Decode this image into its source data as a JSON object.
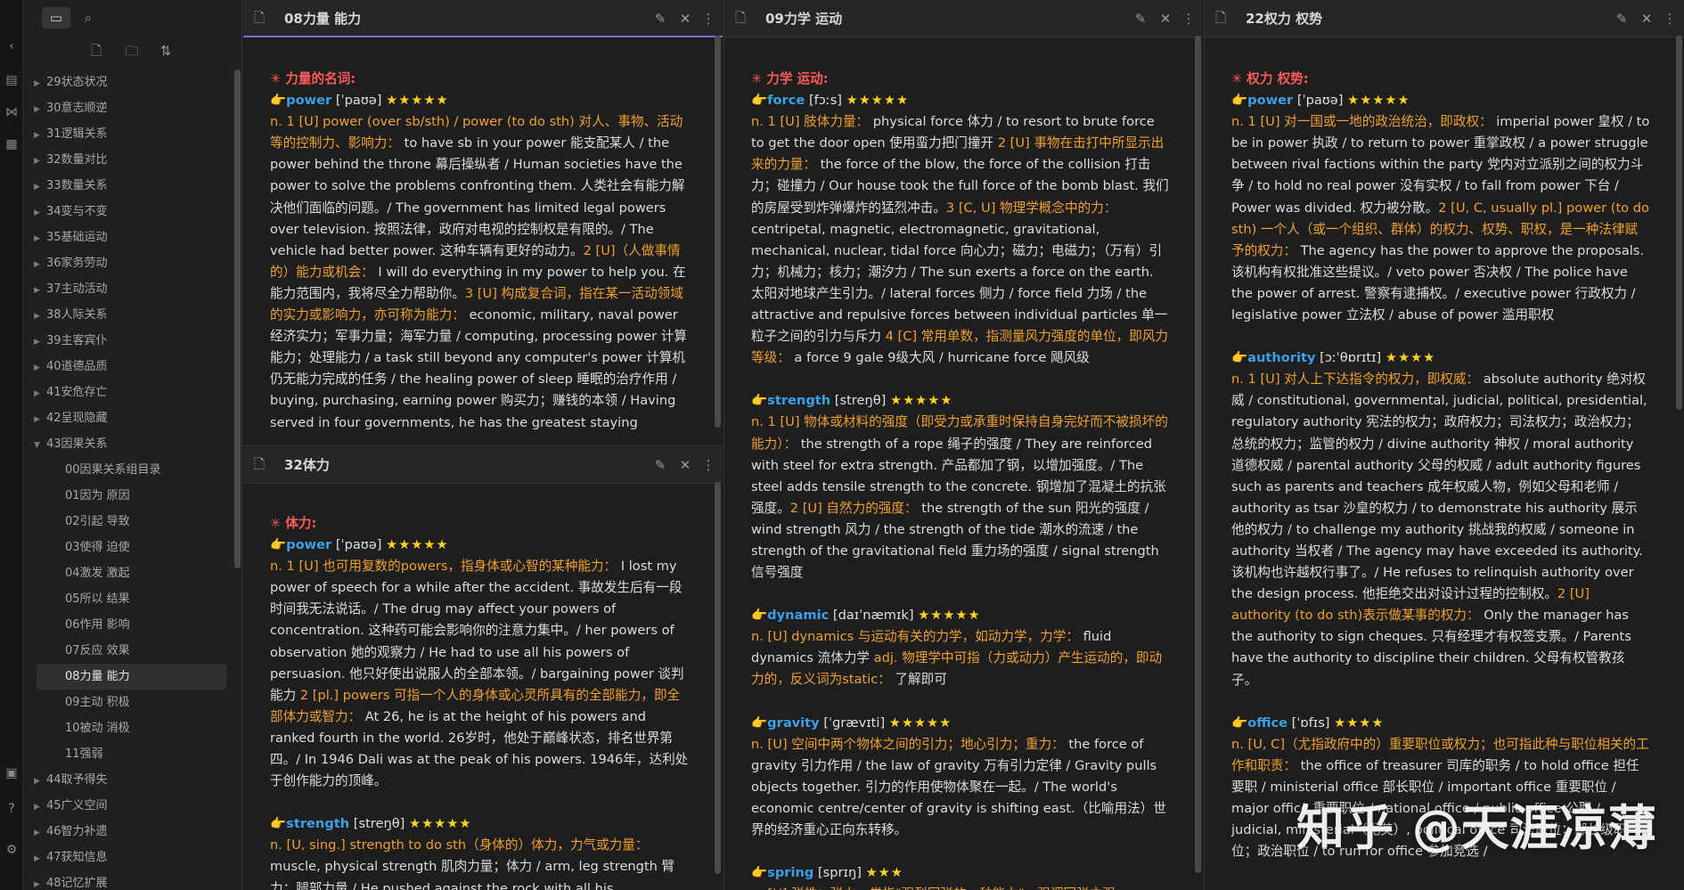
{
  "ribbon": {
    "icons": [
      "collapse-icon",
      "file-icon",
      "graph-icon",
      "blocks-icon",
      "vault-icon",
      "help-icon",
      "settings-icon"
    ]
  },
  "explorer": {
    "tree": [
      {
        "label": "29状态状况",
        "expanded": false
      },
      {
        "label": "30意志顺逆",
        "expanded": false
      },
      {
        "label": "31逻辑关系",
        "expanded": false
      },
      {
        "label": "32数量对比",
        "expanded": false
      },
      {
        "label": "33数量关系",
        "expanded": false
      },
      {
        "label": "34变与不变",
        "expanded": false
      },
      {
        "label": "35基础运动",
        "expanded": false
      },
      {
        "label": "36家务劳动",
        "expanded": false
      },
      {
        "label": "37主动活动",
        "expanded": false
      },
      {
        "label": "38人际关系",
        "expanded": false
      },
      {
        "label": "39主客宾仆",
        "expanded": false
      },
      {
        "label": "40道德品质",
        "expanded": false
      },
      {
        "label": "41安危存亡",
        "expanded": false
      },
      {
        "label": "42呈现隐藏",
        "expanded": false
      },
      {
        "label": "43因果关系",
        "expanded": true
      },
      {
        "label": "00因果关系组目录",
        "child": true
      },
      {
        "label": "01因为 原因",
        "child": true
      },
      {
        "label": "02引起 导致",
        "child": true
      },
      {
        "label": "03使得 迫使",
        "child": true
      },
      {
        "label": "04激发 激起",
        "child": true
      },
      {
        "label": "05所以 结果",
        "child": true
      },
      {
        "label": "06作用 影响",
        "child": true
      },
      {
        "label": "07反应 效果",
        "child": true
      },
      {
        "label": "08力量 能力",
        "child": true,
        "active": true
      },
      {
        "label": "09主动 积极",
        "child": true
      },
      {
        "label": "10被动 消极",
        "child": true
      },
      {
        "label": "11强弱",
        "child": true
      },
      {
        "label": "44取予得失",
        "expanded": false
      },
      {
        "label": "45广义空间",
        "expanded": false
      },
      {
        "label": "46智力补遗",
        "expanded": false
      },
      {
        "label": "47获知信息",
        "expanded": false
      },
      {
        "label": "48记忆扩展",
        "expanded": false
      }
    ]
  },
  "panes": {
    "p08": {
      "title": "08力量 能力",
      "section": "✳ 力量的名词:",
      "entries": [
        {
          "word": "power",
          "phon": "[ˈpaʊə]",
          "stars": "★★★★★",
          "segs": [
            [
              "o",
              "n. 1 [U] power (over sb/sth) / power (to do sth) 对人、事物、活动等的控制力、影响力："
            ],
            [
              "w",
              " to have sb in your power 能支配某人 / the power behind the throne 幕后操纵者 / Human societies have the power to solve the problems confronting them. 人类社会有能力解决他们面临的问题。/ The government has limited legal powers over television. 按照法律，政府对电视的控制权是有限的。/ The vehicle had better power. 这种车辆有更好的动力。"
            ],
            [
              "o",
              "2 [U]（人做事情的）能力或机会："
            ],
            [
              "w",
              " I will do everything in my power to help you. 在能力范围内，我将尽全力帮助你。"
            ],
            [
              "o",
              "3 [U] 构成复合词，指在某一活动领域的实力或影响力，亦可称为能力："
            ],
            [
              "w",
              " economic, military, naval power 经济实力；军事力量；海军力量 / computing, processing power 计算能力；处理能力 / a task still beyond any computer's power 计算机仍无能力完成的任务 / the healing power of sleep 睡眠的治疗作用 / buying, purchasing, earning power 购买力；赚钱的本领 / Having served in four governments, he has the greatest staying"
            ]
          ]
        }
      ]
    },
    "p32": {
      "title": "32体力",
      "section": "✳ 体力:",
      "entries": [
        {
          "word": "power",
          "phon": "[ˈpaʊə]",
          "stars": "★★★★★",
          "segs": [
            [
              "o",
              "n. 1 [U] 也可用复数的powers，指身体或心智的某种能力："
            ],
            [
              "w",
              " I lost my power of speech for a while after the accident. 事故发生后有一段时间我无法说话。/ The drug may affect your powers of concentration. 这种药可能会影响你的注意力集中。/ her powers of observation 她的观察力 / He had to use all his powers of persuasion. 他只好使出说服人的全部本领。/ bargaining power 谈判能力 "
            ],
            [
              "o",
              "2 [pl.] powers 可指一个人的身体或心灵所具有的全部能力，即全部体力或智力："
            ],
            [
              "w",
              " At 26, he is at the height of his powers and ranked fourth in the world. 26岁时，他处于巅峰状态，排名世界第四。/ In 1946 Dali was at the peak of his powers. 1946年，达利处于创作能力的顶峰。"
            ]
          ]
        },
        {
          "word": "strength",
          "phon": "[streŋθ]",
          "stars": "★★★★★",
          "segs": [
            [
              "o",
              "n. [U, sing.] strength to do sth（身体的）体力，力气或力量："
            ],
            [
              "w",
              " muscle, physical strength 肌肉力量；体力 / arm, leg strength 臂力；腿部力量 / He pushed against the rock with all his"
            ]
          ]
        }
      ]
    },
    "p09": {
      "title": "09力学 运动",
      "section": "✳ 力学 运动:",
      "entries": [
        {
          "word": "force",
          "phon": "[fɔːs]",
          "stars": "★★★★★",
          "segs": [
            [
              "o",
              "n. 1 [U] 肢体力量："
            ],
            [
              "w",
              " physical force 体力 / to resort to brute force to get the door open 使用蛮力把门撞开 "
            ],
            [
              "o",
              "2 [U] 事物在击打中所显示出来的力量："
            ],
            [
              "w",
              " the force of the blow, the force of the collision 打击力；碰撞力 / Our house took the full force of the bomb blast. 我们的房屋受到炸弹爆炸的猛烈冲击。"
            ],
            [
              "o",
              "3 [C, U] 物理学概念中的力："
            ],
            [
              "w",
              " centripetal, magnetic, electromagnetic, gravitational, mechanical, nuclear, tidal force 向心力；磁力；电磁力；（万有）引力；机械力；核力；潮汐力 / The sun exerts a force on the earth. 太阳对地球产生引力。/ lateral forces 侧力 / force field 力场 / the attractive and repulsive forces between individual particles 单一粒子之间的引力与斥力 "
            ],
            [
              "o",
              "4 [C] 常用单数，指测量风力强度的单位，即风力等级："
            ],
            [
              "w",
              " a force 9 gale 9级大风 / hurricane force 飓风级"
            ]
          ]
        },
        {
          "word": "strength",
          "phon": "[streŋθ]",
          "stars": "★★★★★",
          "segs": [
            [
              "o",
              "n. 1 [U] 物体或材料的强度（即受力或承重时保持自身完好而不被损坏的能力）："
            ],
            [
              "w",
              " the strength of a rope 绳子的强度 / They are reinforced with steel for extra strength. 产品都加了钢，以增加强度。/ The steel adds tensile strength to the concrete. 钢增加了混凝土的抗张强度。"
            ],
            [
              "o",
              "2 [U] 自然力的强度："
            ],
            [
              "w",
              " the strength of the sun 阳光的强度 / wind strength 风力 / the strength of the tide 潮水的流速 / the strength of the gravitational field 重力场的强度 / signal strength 信号强度"
            ]
          ]
        },
        {
          "word": "dynamic",
          "phon": "[daɪˈnæmɪk]",
          "stars": "★★★★★",
          "segs": [
            [
              "o",
              "n. [U] dynamics 与运动有关的力学，如动力学，力学："
            ],
            [
              "w",
              " fluid dynamics 流体力学 "
            ],
            [
              "o",
              "adj. 物理学中可指（力或动力）产生运动的，即动力的，反义词为static："
            ],
            [
              "w",
              " 了解即可"
            ]
          ]
        },
        {
          "word": "gravity",
          "phon": "[ˈɡrævɪti]",
          "stars": "★★★★★",
          "segs": [
            [
              "o",
              "n. [U] 空间中两个物体之间的引力；地心引力；重力："
            ],
            [
              "w",
              " the force of gravity 引力作用 / the law of gravity 万有引力定律 / Gravity pulls objects together. 引力的作用使物体聚在一起。/ The world's economic centre/center of gravity is shifting east.（比喻用法）世界的经济重心正向东转移。"
            ]
          ]
        },
        {
          "word": "spring",
          "phon": "[sprɪŋ]",
          "stars": "★★★",
          "segs": [
            [
              "o",
              "n. [U] 弹性；弹力，常指\"强烈回弹的一种能力\"，强调回弹之强"
            ]
          ]
        }
      ]
    },
    "p22": {
      "title": "22权力 权势",
      "section": "✳ 权力 权势:",
      "entries": [
        {
          "word": "power",
          "phon": "[ˈpaʊə]",
          "stars": "★★★★★",
          "segs": [
            [
              "o",
              "n. 1 [U] 对一国或一地的政治统治，即政权："
            ],
            [
              "w",
              " imperial power 皇权 / to be in power 执政 / to return to power 重掌政权 / a power struggle between rival factions within the party 党内对立派别之间的权力斗争 / to hold no real power 没有实权 / to fall from power 下台 / Power was divided. 权力被分散。"
            ],
            [
              "o",
              "2 [U, C, usually pl.] power (to do sth) 一个人（或一个组织、群体）的权力、权势、职权，是一种法律赋予的权力："
            ],
            [
              "w",
              " The agency has the power to approve the proposals. 该机构有权批准这些提议。/ veto power 否决权 / The police have the power of arrest. 警察有逮捕权。/ executive power 行政权力 / legislative power 立法权 / abuse of power 滥用职权"
            ]
          ]
        },
        {
          "word": "authority",
          "phon": "[ɔːˈθɒrɪtɪ]",
          "stars": "★★★★",
          "segs": [
            [
              "o",
              "n. 1 [U] 对人上下达指令的权力，即权威："
            ],
            [
              "w",
              " absolute authority 绝对权威 / constitutional, governmental, judicial, political, presidential, regulatory authority 宪法的权力；政府权力；司法权力；政治权力；总统的权力；监管的权力 / divine authority 神权 / moral authority 道德权威 / parental authority 父母的权威 / adult authority figures such as parents and teachers 成年权威人物，例如父母和老师 / authority as tsar 沙皇的权力 / to demonstrate his authority 展示他的权力 / to challenge my authority 挑战我的权威 / someone in authority 当权者 / The agency may have exceeded its authority. 该机构也许越权行事了。/ He refuses to relinquish authority over the design process. 他拒绝交出对设计过程的控制权。"
            ],
            [
              "o",
              "2 [U] authority (to do sth)表示做某事的权力："
            ],
            [
              "w",
              " Only the manager has the authority to sign cheques. 只有经理才有权签支票。/ Parents have the authority to discipline their children. 父母有权管教孩子。"
            ]
          ]
        },
        {
          "word": "office",
          "phon": "[ˈɒfɪs]",
          "stars": "★★★★",
          "segs": [
            [
              "o",
              "n. [U, C]（尤指政府中的）重要职位或权力；也可指此种与职位相关的工作和职责："
            ],
            [
              "w",
              " the office of treasurer 司库的职务 / to hold office 担任要职 / ministerial office 部长职位 / important office 重要职位 / major office 重要职位 / national office / public office 公职 / judicial, ministerial（尤英）, political office 司法职位；部长级职位；政治职位 / to run for office 参加竞选 /"
            ]
          ]
        }
      ]
    }
  },
  "watermark": "知乎 @天涯凉薄"
}
